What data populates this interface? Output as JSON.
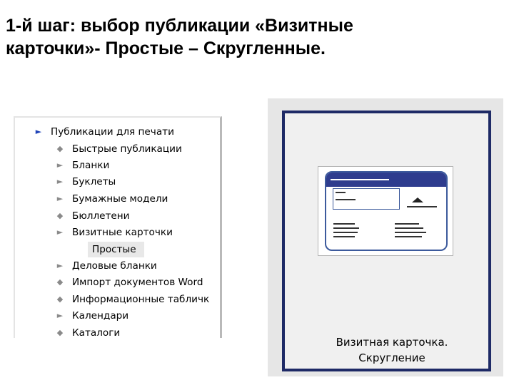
{
  "slide": {
    "title_line1": "1-й шаг: выбор публикации «Визитные",
    "title_line2": "карточки»- Простые – Скругленные."
  },
  "tree": {
    "root": "Публикации для печати",
    "items": [
      {
        "label": "Быстрые публикации",
        "icon": "diamond-bullet-icon"
      },
      {
        "label": "Бланки",
        "icon": "expand-arrow-icon"
      },
      {
        "label": "Буклеты",
        "icon": "expand-arrow-icon"
      },
      {
        "label": "Бумажные модели",
        "icon": "expand-arrow-icon"
      },
      {
        "label": "Бюллетени",
        "icon": "diamond-bullet-icon"
      },
      {
        "label": "Визитные карточки",
        "icon": "expand-arrow-icon"
      },
      {
        "label": "Деловые бланки",
        "icon": "expand-arrow-icon"
      },
      {
        "label": "Импорт документов Word",
        "icon": "diamond-bullet-icon"
      },
      {
        "label": "Информационные табличк",
        "icon": "diamond-bullet-icon"
      },
      {
        "label": "Календари",
        "icon": "expand-arrow-icon"
      },
      {
        "label": "Каталоги",
        "icon": "diamond-bullet-icon"
      }
    ],
    "selected_child": "Простые"
  },
  "preview": {
    "caption_line1": "Визитная карточка.",
    "caption_line2": "Скругление"
  },
  "colors": {
    "frame": "#1e2a66",
    "card_band": "#2e3c8e",
    "root_arrow": "#1f43b8"
  }
}
